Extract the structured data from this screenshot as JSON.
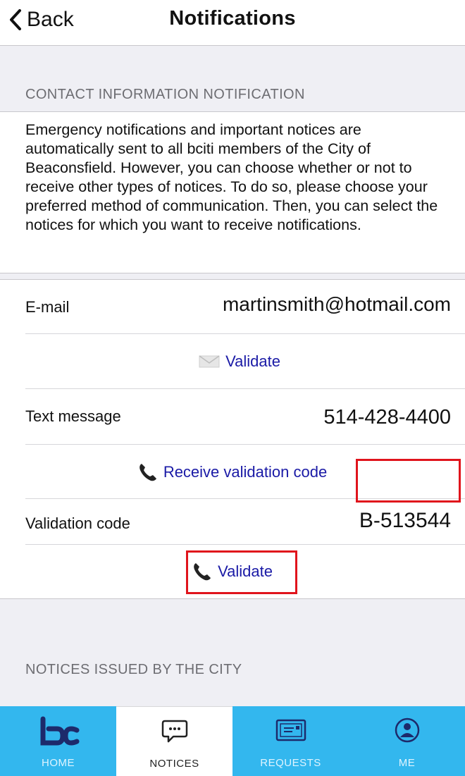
{
  "nav": {
    "back_label": "Back",
    "title": "Notifications"
  },
  "contact_section": {
    "header": "CONTACT INFORMATION NOTIFICATION",
    "description": "Emergency notifications and important notices are automatically sent to all bciti members of the City of Beaconsfield. However, you can choose whether or not to receive other types of notices. To do so, please choose your preferred method of communication. Then, you can select the notices for which you want to receive notifications."
  },
  "email": {
    "label": "E-mail",
    "value": "martinsmith@hotmail.com",
    "validate_label": "Validate",
    "icon": "envelope-icon"
  },
  "text_message": {
    "label": "Text message",
    "value": "514-428-4400",
    "receive_code_label": "Receive validation code",
    "icon": "phone-icon"
  },
  "validation": {
    "label": "Validation code",
    "value": "B-513544",
    "validate_label": "Validate"
  },
  "notices_section": {
    "header": "NOTICES ISSUED BY THE CITY"
  },
  "tabs": [
    {
      "label": "HOME",
      "icon": "bc-logo-icon",
      "active": false
    },
    {
      "label": "NOTICES",
      "icon": "chat-bubble-icon",
      "active": true
    },
    {
      "label": "REQUESTS",
      "icon": "ticket-icon",
      "active": false
    },
    {
      "label": "ME",
      "icon": "user-circle-icon",
      "active": false
    }
  ],
  "colors": {
    "tab_bar": "#33b7ee",
    "link": "#1a1aa6",
    "highlight": "#e0141c",
    "background": "#efeff4"
  }
}
